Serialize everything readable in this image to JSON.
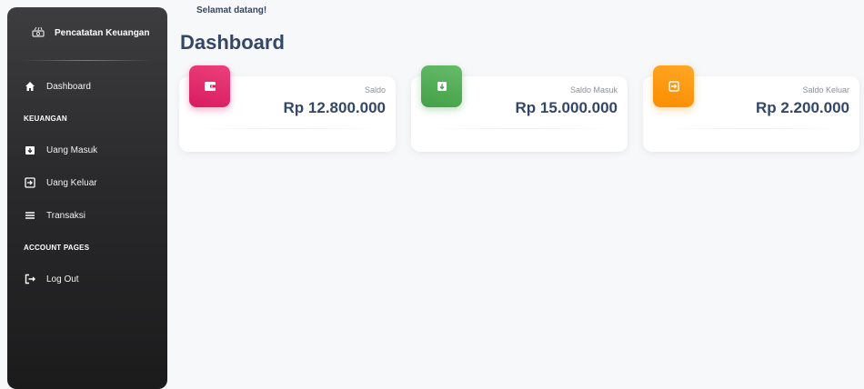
{
  "sidebar": {
    "brand": "Pencatatan Keuangan",
    "items": [
      {
        "label": "Dashboard",
        "icon": "home-icon"
      },
      {
        "label": "Uang Masuk",
        "icon": "wallet-in-icon"
      },
      {
        "label": "Uang Keluar",
        "icon": "sign-in-icon"
      },
      {
        "label": "Transaksi",
        "icon": "list-icon"
      },
      {
        "label": "Log Out",
        "icon": "logout-icon"
      }
    ],
    "sections": [
      "KEUANGAN",
      "ACCOUNT PAGES"
    ]
  },
  "header": {
    "greeting": "Selamat datang!",
    "title": "Dashboard"
  },
  "cards": [
    {
      "label": "Saldo",
      "value": "Rp 12.800.000",
      "color": "#e91e63",
      "icon": "wallet-icon"
    },
    {
      "label": "Saldo Masuk",
      "value": "Rp 15.000.000",
      "color": "#4caf50",
      "icon": "money-in-icon"
    },
    {
      "label": "Saldo Keluar",
      "value": "Rp 2.200.000",
      "color": "#fb8c00",
      "icon": "money-out-icon"
    }
  ]
}
